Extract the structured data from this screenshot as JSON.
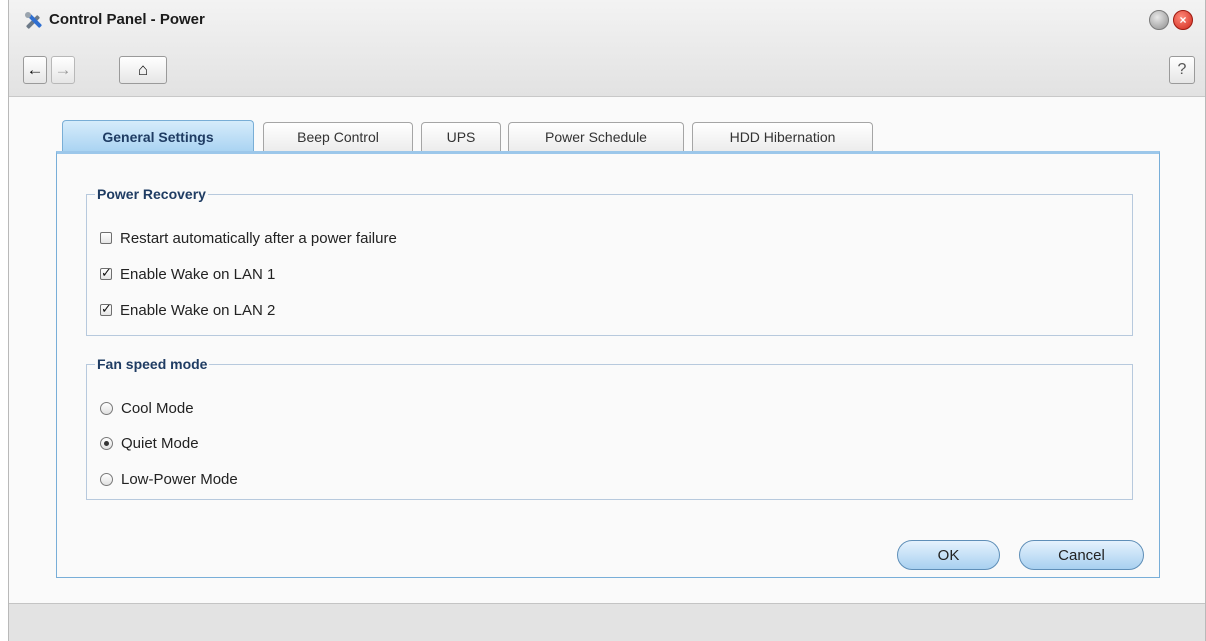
{
  "window": {
    "title": "Control Panel - Power",
    "app_icon": "control-panel-tools-icon"
  },
  "toolbar": {
    "back_icon": "←",
    "forward_icon": "→",
    "home_icon": "⌂",
    "help_label": "?"
  },
  "tabs": [
    {
      "label": "General Settings",
      "active": true
    },
    {
      "label": "Beep Control",
      "active": false
    },
    {
      "label": "UPS",
      "active": false
    },
    {
      "label": "Power Schedule",
      "active": false
    },
    {
      "label": "HDD Hibernation",
      "active": false
    }
  ],
  "power_recovery": {
    "legend": "Power Recovery",
    "options": [
      {
        "label": "Restart automatically after a power failure",
        "checked": false
      },
      {
        "label": "Enable Wake on LAN 1",
        "checked": true
      },
      {
        "label": "Enable Wake on LAN 2",
        "checked": true
      }
    ]
  },
  "fan_speed": {
    "legend": "Fan speed mode",
    "options": [
      {
        "label": "Cool Mode",
        "selected": false
      },
      {
        "label": "Quiet Mode",
        "selected": true
      },
      {
        "label": "Low-Power Mode",
        "selected": false
      }
    ]
  },
  "buttons": {
    "ok": "OK",
    "cancel": "Cancel"
  },
  "colors": {
    "accent": "#a9d3f2",
    "legend": "#1f3c63",
    "close": "#d0271b"
  }
}
